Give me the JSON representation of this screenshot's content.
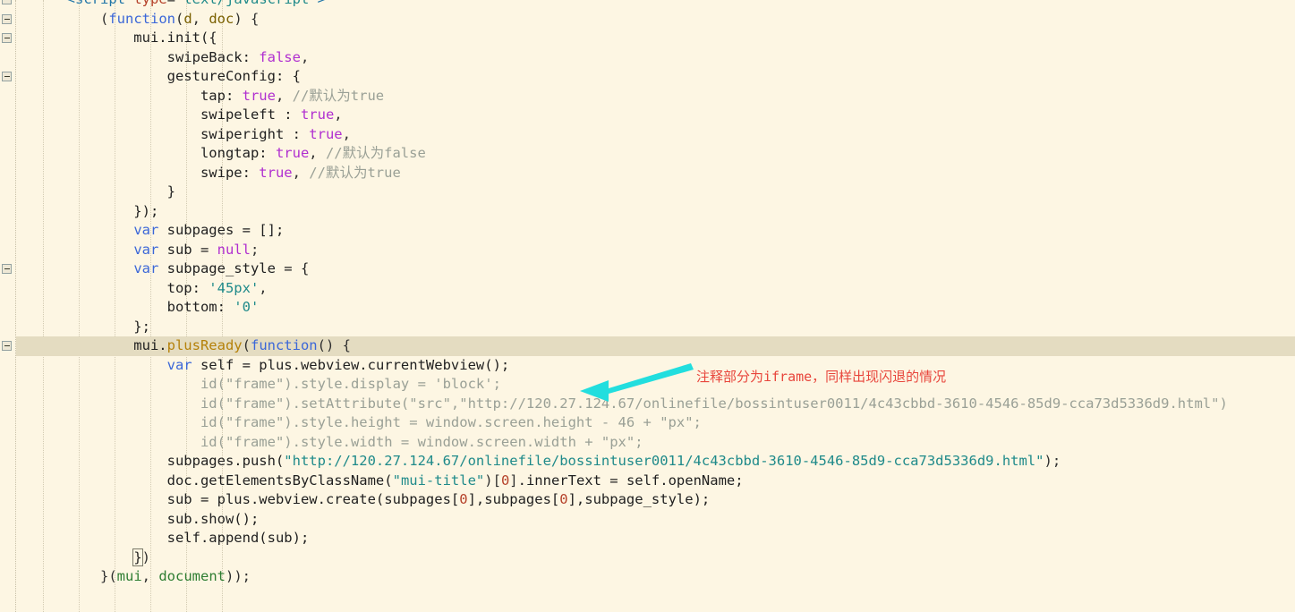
{
  "editor": {
    "theme_background": "#fdf6e3",
    "highlight_line_background": "#e4dcc1",
    "language": "javascript",
    "partial_top_line": "        <script type=\"text/javascript\">"
  },
  "annotation": {
    "text": "注释部分为iframe，同样出现闪退的情况",
    "color": "#e8463c",
    "arrow_color": "#22dede",
    "arrow_name": "arrow-pointing-left"
  },
  "gutter": {
    "fold_marker_name": "code-fold-collapse-icon",
    "fold_rows": [
      0,
      1,
      2,
      4,
      14,
      18
    ]
  },
  "code_lines": [
    {
      "indent": 0,
      "tokens": [
        {
          "t": "        ",
          "c": "t-def"
        },
        {
          "t": "<",
          "c": "t-tag"
        },
        {
          "t": "script",
          "c": "t-tag"
        },
        {
          "t": " ",
          "c": "t-def"
        },
        {
          "t": "type",
          "c": "t-attr"
        },
        {
          "t": "=",
          "c": "t-pun"
        },
        {
          "t": "\"text/javascript\"",
          "c": "t-str"
        },
        {
          "t": ">",
          "c": "t-tag"
        }
      ]
    },
    {
      "indent": 0,
      "tokens": [
        {
          "t": "            (",
          "c": "t-pun"
        },
        {
          "t": "function",
          "c": "t-kw"
        },
        {
          "t": "(",
          "c": "t-pun"
        },
        {
          "t": "d",
          "c": "t-par"
        },
        {
          "t": ", ",
          "c": "t-pun"
        },
        {
          "t": "doc",
          "c": "t-par"
        },
        {
          "t": ") {",
          "c": "t-pun"
        }
      ]
    },
    {
      "indent": 0,
      "tokens": [
        {
          "t": "                mui.init({",
          "c": "t-def"
        }
      ]
    },
    {
      "indent": 0,
      "tokens": [
        {
          "t": "                    swipeBack: ",
          "c": "t-def"
        },
        {
          "t": "false",
          "c": "t-bool"
        },
        {
          "t": ",",
          "c": "t-pun"
        }
      ]
    },
    {
      "indent": 0,
      "tokens": [
        {
          "t": "                    gestureConfig: {",
          "c": "t-def"
        }
      ]
    },
    {
      "indent": 0,
      "tokens": [
        {
          "t": "                        tap: ",
          "c": "t-def"
        },
        {
          "t": "true",
          "c": "t-bool"
        },
        {
          "t": ", ",
          "c": "t-pun"
        },
        {
          "t": "//默认为true",
          "c": "t-com"
        }
      ]
    },
    {
      "indent": 0,
      "tokens": [
        {
          "t": "                        swipeleft : ",
          "c": "t-def"
        },
        {
          "t": "true",
          "c": "t-bool"
        },
        {
          "t": ",",
          "c": "t-pun"
        }
      ]
    },
    {
      "indent": 0,
      "tokens": [
        {
          "t": "                        swiperight : ",
          "c": "t-def"
        },
        {
          "t": "true",
          "c": "t-bool"
        },
        {
          "t": ",",
          "c": "t-pun"
        }
      ]
    },
    {
      "indent": 0,
      "tokens": [
        {
          "t": "                        longtap: ",
          "c": "t-def"
        },
        {
          "t": "true",
          "c": "t-bool"
        },
        {
          "t": ", ",
          "c": "t-pun"
        },
        {
          "t": "//默认为false",
          "c": "t-com"
        }
      ]
    },
    {
      "indent": 0,
      "tokens": [
        {
          "t": "                        swipe: ",
          "c": "t-def"
        },
        {
          "t": "true",
          "c": "t-bool"
        },
        {
          "t": ", ",
          "c": "t-pun"
        },
        {
          "t": "//默认为true",
          "c": "t-com"
        }
      ]
    },
    {
      "indent": 0,
      "tokens": [
        {
          "t": "                    }",
          "c": "t-def"
        }
      ]
    },
    {
      "indent": 0,
      "tokens": [
        {
          "t": "                });",
          "c": "t-def"
        }
      ]
    },
    {
      "indent": 0,
      "tokens": [
        {
          "t": "                ",
          "c": "t-def"
        },
        {
          "t": "var",
          "c": "t-kw"
        },
        {
          "t": " subpages = [];",
          "c": "t-def"
        }
      ]
    },
    {
      "indent": 0,
      "tokens": [
        {
          "t": "                ",
          "c": "t-def"
        },
        {
          "t": "var",
          "c": "t-kw"
        },
        {
          "t": " sub = ",
          "c": "t-def"
        },
        {
          "t": "null",
          "c": "t-bool"
        },
        {
          "t": ";",
          "c": "t-pun"
        }
      ]
    },
    {
      "indent": 0,
      "tokens": [
        {
          "t": "                ",
          "c": "t-def"
        },
        {
          "t": "var",
          "c": "t-kw"
        },
        {
          "t": " subpage_style = {",
          "c": "t-def"
        }
      ]
    },
    {
      "indent": 0,
      "tokens": [
        {
          "t": "                    top: ",
          "c": "t-def"
        },
        {
          "t": "'45px'",
          "c": "t-str"
        },
        {
          "t": ",",
          "c": "t-pun"
        }
      ]
    },
    {
      "indent": 0,
      "tokens": [
        {
          "t": "                    bottom: ",
          "c": "t-def"
        },
        {
          "t": "'0'",
          "c": "t-str"
        }
      ]
    },
    {
      "indent": 0,
      "tokens": [
        {
          "t": "                };",
          "c": "t-def"
        }
      ]
    },
    {
      "indent": 0,
      "highlight": true,
      "tokens": [
        {
          "t": "                mui.",
          "c": "t-def"
        },
        {
          "t": "plusReady",
          "c": "t-fn"
        },
        {
          "t": "(",
          "c": "t-pun"
        },
        {
          "t": "function",
          "c": "t-kw"
        },
        {
          "t": "() {",
          "c": "t-pun"
        }
      ]
    },
    {
      "indent": 0,
      "tokens": [
        {
          "t": "                    ",
          "c": "t-def"
        },
        {
          "t": "var",
          "c": "t-kw"
        },
        {
          "t": " self = plus.webview.currentWebview();",
          "c": "t-def"
        }
      ]
    },
    {
      "indent": 0,
      "comment_row": true,
      "tokens": [
        {
          "t": "//",
          "c": "slash"
        },
        {
          "t": "                      id(\"frame\").style.display = 'block';",
          "c": "t-com"
        }
      ]
    },
    {
      "indent": 0,
      "comment_row": true,
      "tokens": [
        {
          "t": "//",
          "c": "slash"
        },
        {
          "t": "                      id(\"frame\").setAttribute(\"src\",\"http://120.27.124.67/onlinefile/bossintuser0011/4c43cbbd-3610-4546-85d9-cca73d5336d9.html\")",
          "c": "t-com"
        }
      ]
    },
    {
      "indent": 0,
      "comment_row": true,
      "tokens": [
        {
          "t": "//",
          "c": "slash"
        },
        {
          "t": "                      id(\"frame\").style.height = window.screen.height - 46 + \"px\";",
          "c": "t-com"
        }
      ]
    },
    {
      "indent": 0,
      "comment_row": true,
      "tokens": [
        {
          "t": "//",
          "c": "slash"
        },
        {
          "t": "                      id(\"frame\").style.width = window.screen.width + \"px\";",
          "c": "t-com"
        }
      ]
    },
    {
      "indent": 0,
      "tokens": [
        {
          "t": "                    subpages.push(",
          "c": "t-def"
        },
        {
          "t": "\"http://120.27.124.67/onlinefile/bossintuser0011/4c43cbbd-3610-4546-85d9-cca73d5336d9.html\"",
          "c": "t-str"
        },
        {
          "t": ");",
          "c": "t-pun"
        }
      ]
    },
    {
      "indent": 0,
      "tokens": [
        {
          "t": "                    doc.getElementsByClassName(",
          "c": "t-def"
        },
        {
          "t": "\"mui-title\"",
          "c": "t-str"
        },
        {
          "t": ")[",
          "c": "t-pun"
        },
        {
          "t": "0",
          "c": "t-num"
        },
        {
          "t": "]",
          "c": "t-pun"
        },
        {
          "t": ".innerText = self.openName;",
          "c": "t-def"
        }
      ]
    },
    {
      "indent": 0,
      "tokens": [
        {
          "t": "                    sub = plus.webview.create(subpages[",
          "c": "t-def"
        },
        {
          "t": "0",
          "c": "t-num"
        },
        {
          "t": "],subpages[",
          "c": "t-def"
        },
        {
          "t": "0",
          "c": "t-num"
        },
        {
          "t": "],subpage_style);",
          "c": "t-def"
        }
      ]
    },
    {
      "indent": 0,
      "tokens": [
        {
          "t": "                    sub.show();",
          "c": "t-def"
        }
      ]
    },
    {
      "indent": 0,
      "tokens": [
        {
          "t": "                    self.append(sub);",
          "c": "t-def"
        }
      ]
    },
    {
      "indent": 0,
      "brace_box_col": 16,
      "tokens": [
        {
          "t": "                ",
          "c": "t-def"
        },
        {
          "t": "}",
          "c": "t-def",
          "box": true
        },
        {
          "t": ")",
          "c": "t-pun"
        }
      ]
    },
    {
      "indent": 0,
      "tokens": [
        {
          "t": "            }(",
          "c": "t-pun"
        },
        {
          "t": "mui",
          "c": "t-grn"
        },
        {
          "t": ", ",
          "c": "t-pun"
        },
        {
          "t": "document",
          "c": "t-grn"
        },
        {
          "t": "));",
          "c": "t-pun"
        }
      ]
    }
  ]
}
